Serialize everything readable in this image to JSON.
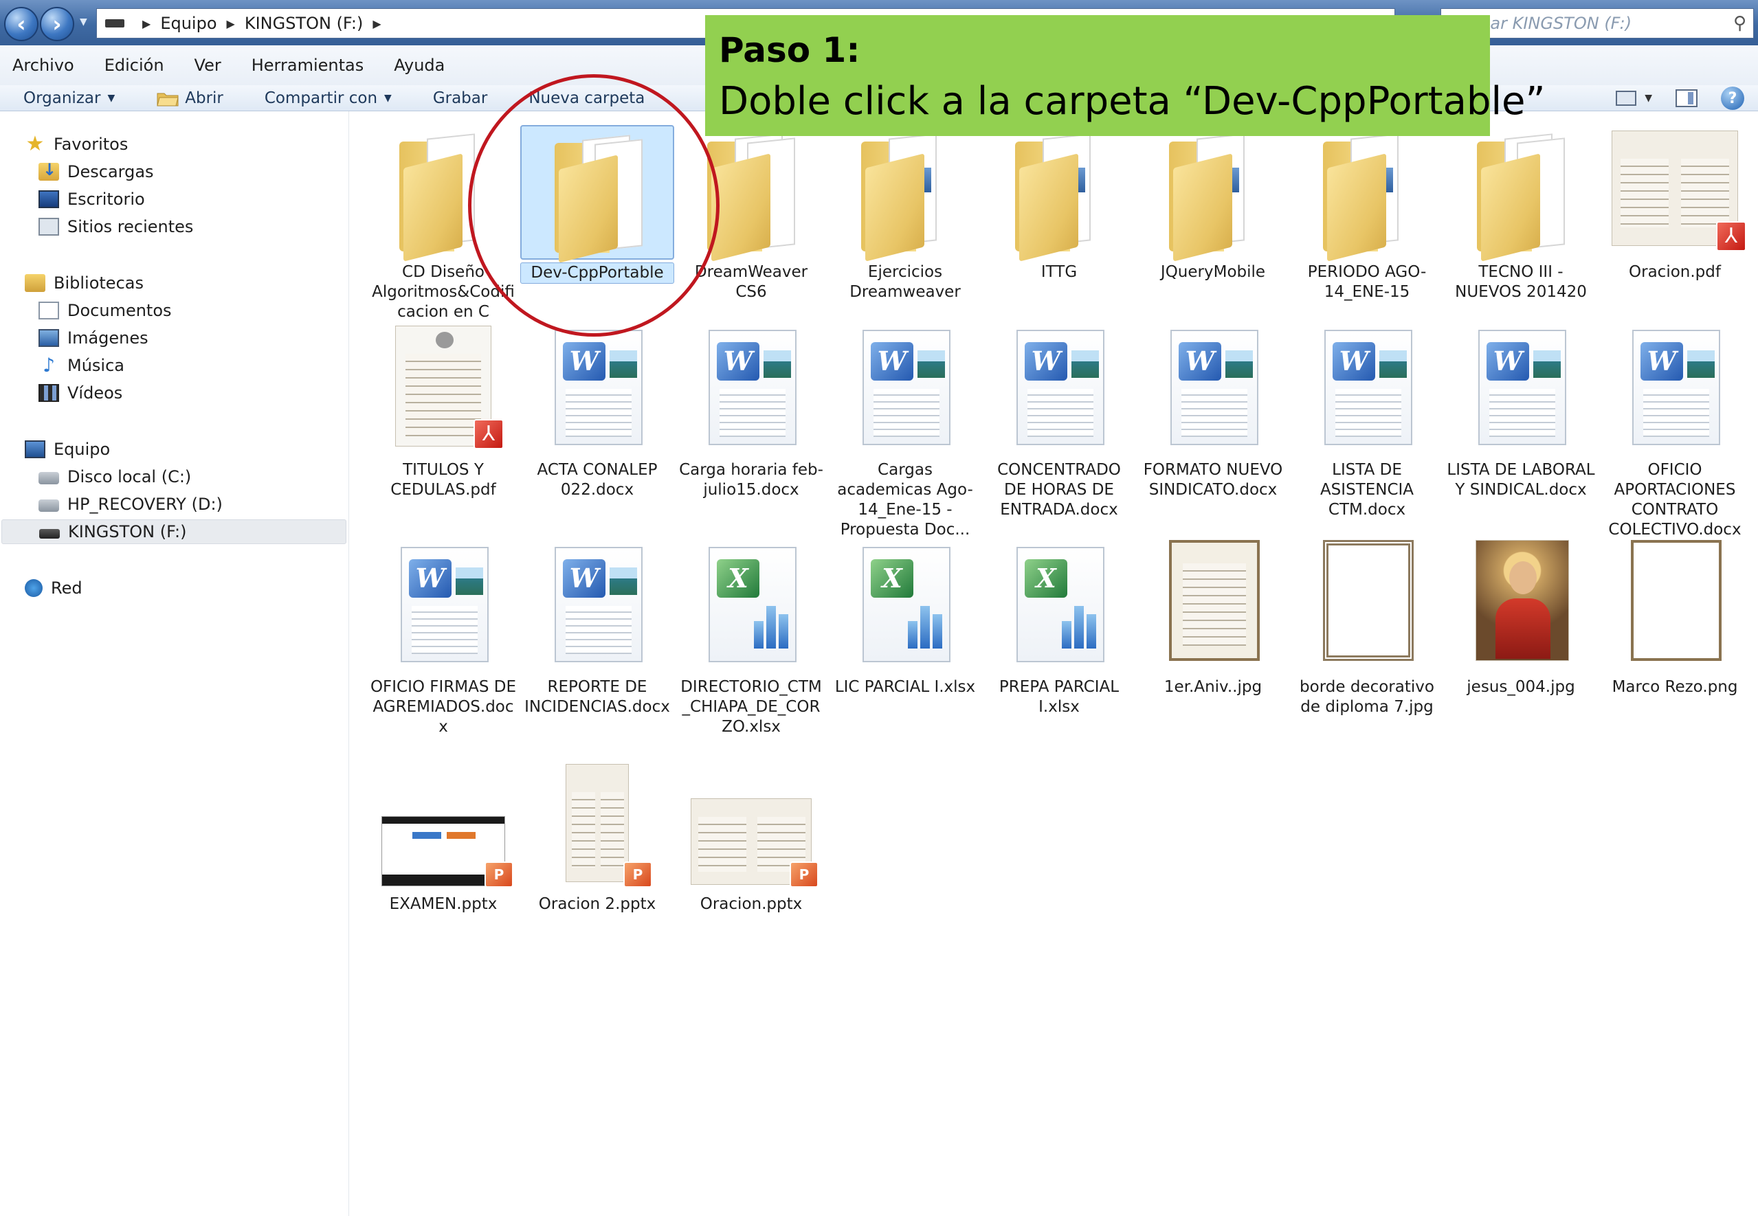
{
  "address": {
    "crumbs": [
      "Equipo",
      "KINGSTON (F:)"
    ],
    "search_placeholder": "Buscar KINGSTON (F:)"
  },
  "menu": [
    "Archivo",
    "Edición",
    "Ver",
    "Herramientas",
    "Ayuda"
  ],
  "toolbar": {
    "organize": "Organizar",
    "open": "Abrir",
    "share": "Compartir con",
    "burn": "Grabar",
    "new_folder": "Nueva carpeta"
  },
  "nav": {
    "favorites": "Favoritos",
    "downloads": "Descargas",
    "desktop": "Escritorio",
    "recent": "Sitios recientes",
    "libraries": "Bibliotecas",
    "documents": "Documentos",
    "images": "Imágenes",
    "music": "Música",
    "videos": "Vídeos",
    "computer": "Equipo",
    "local_disk": "Disco local (C:)",
    "recovery": "HP_RECOVERY (D:)",
    "kingston": "KINGSTON (F:)",
    "network": "Red"
  },
  "files": {
    "f1": "CD Diseño Algoritmos&Codificacion en C",
    "f2": "Dev-CppPortable",
    "f3": "DreamWeaver CS6",
    "f4": "Ejercicios Dreamweaver",
    "f5": "ITTG",
    "f6": "JQueryMobile",
    "f7": "PERIODO AGO-14_ENE-15",
    "f8": "TECNO III - NUEVOS 201420",
    "f9": "Oracion.pdf",
    "d1": "TITULOS Y CEDULAS.pdf",
    "d2": "ACTA CONALEP 022.docx",
    "d3": "Carga horaria feb-julio15.docx",
    "d4": "Cargas academicas Ago-14_Ene-15 -Propuesta Doc...",
    "d5": "CONCENTRADO DE HORAS DE ENTRADA.docx",
    "d6": "FORMATO NUEVO SINDICATO.docx",
    "d7": "LISTA DE ASISTENCIA CTM.docx",
    "d8": "LISTA DE LABORAL Y SINDICAL.docx",
    "d9": "OFICIO APORTACIONES CONTRATO COLECTIVO.docx",
    "e1": "OFICIO FIRMAS DE AGREMIADOS.docx",
    "e2": "REPORTE DE INCIDENCIAS.docx",
    "e3": "DIRECTORIO_CTM_CHIAPA_DE_CORZO.xlsx",
    "e4": "LIC PARCIAL I.xlsx",
    "e5": "PREPA PARCIAL I.xlsx",
    "e6": "1er.Aniv..jpg",
    "e7": "borde decorativo de diploma 7.jpg",
    "e8": "jesus_004.jpg",
    "e9": "Marco Rezo.png",
    "p1": "EXAMEN.pptx",
    "p2": "Oracion 2.pptx",
    "p3": "Oracion.pptx"
  },
  "callout": {
    "title": "Paso 1:",
    "text": "Doble click a la carpeta “Dev-CppPortable”",
    "color": "#92d050",
    "ring_color": "#c0171f"
  }
}
